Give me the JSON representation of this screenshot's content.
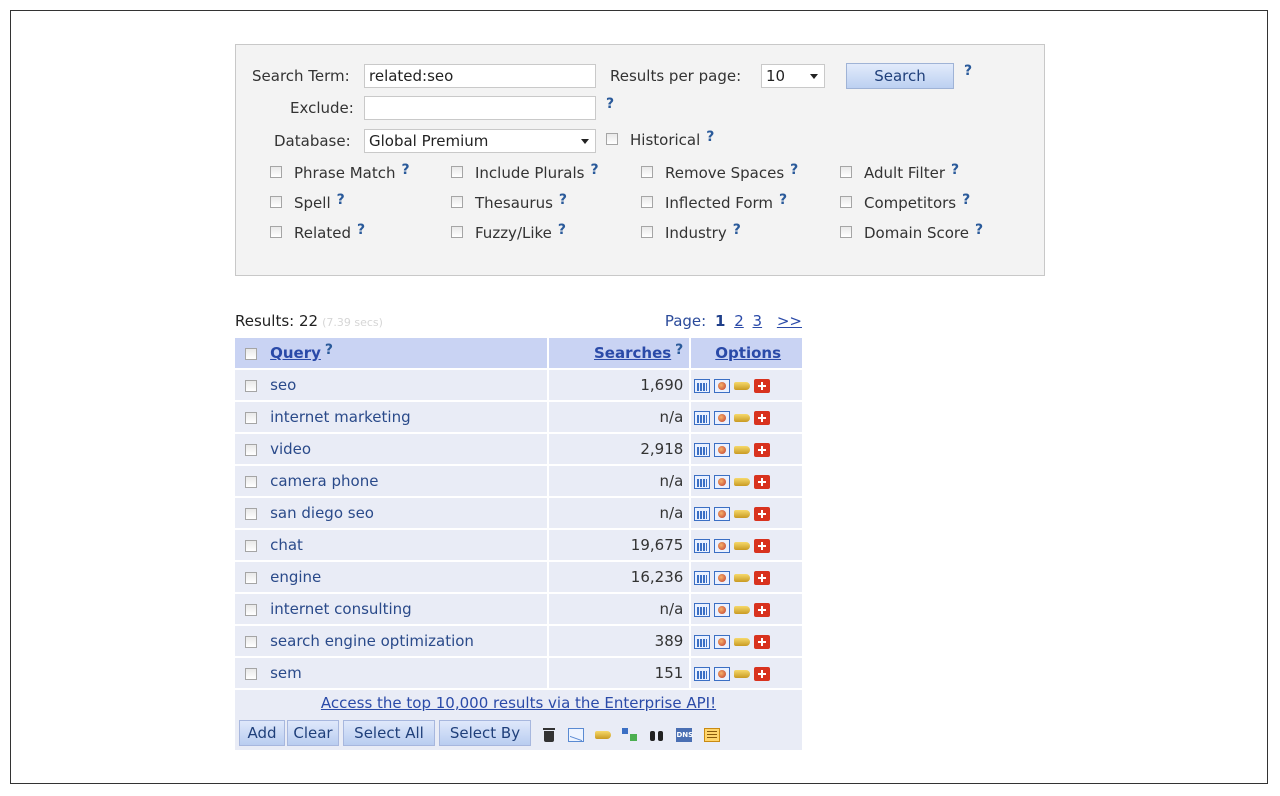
{
  "search": {
    "term_label": "Search Term:",
    "term_value": "related:seo",
    "exclude_label": "Exclude:",
    "exclude_value": "",
    "database_label": "Database:",
    "database_value": "Global Premium",
    "historical_label": "Historical",
    "results_per_page_label": "Results per page:",
    "results_per_page_value": "10",
    "search_button": "Search",
    "help": "?",
    "options": [
      {
        "label": "Phrase Match"
      },
      {
        "label": "Include Plurals"
      },
      {
        "label": "Remove Spaces"
      },
      {
        "label": "Adult Filter"
      },
      {
        "label": "Spell"
      },
      {
        "label": "Thesaurus"
      },
      {
        "label": "Inflected Form"
      },
      {
        "label": "Competitors"
      },
      {
        "label": "Related"
      },
      {
        "label": "Fuzzy/Like"
      },
      {
        "label": "Industry"
      },
      {
        "label": "Domain Score"
      }
    ]
  },
  "results": {
    "label": "Results: 22",
    "time": "(7.39 secs)",
    "page_label": "Page:",
    "pages": [
      "1",
      "2",
      "3"
    ],
    "next": ">>",
    "columns": {
      "query": "Query",
      "searches": "Searches",
      "options": "Options"
    },
    "rows": [
      {
        "query": "seo",
        "searches": "1,690"
      },
      {
        "query": "internet marketing",
        "searches": "n/a"
      },
      {
        "query": "video",
        "searches": "2,918"
      },
      {
        "query": "camera phone",
        "searches": "n/a"
      },
      {
        "query": "san diego seo",
        "searches": "n/a"
      },
      {
        "query": "chat",
        "searches": "19,675"
      },
      {
        "query": "engine",
        "searches": "16,236"
      },
      {
        "query": "internet consulting",
        "searches": "n/a"
      },
      {
        "query": "search engine optimization",
        "searches": "389"
      },
      {
        "query": "sem",
        "searches": "151"
      }
    ],
    "api_link": "Access the top 10,000 results via the Enterprise API!"
  },
  "toolbar": {
    "add": "Add",
    "clear": "Clear",
    "select_all": "Select All",
    "select_by": "Select By",
    "dns_icon_text": "DNS"
  }
}
